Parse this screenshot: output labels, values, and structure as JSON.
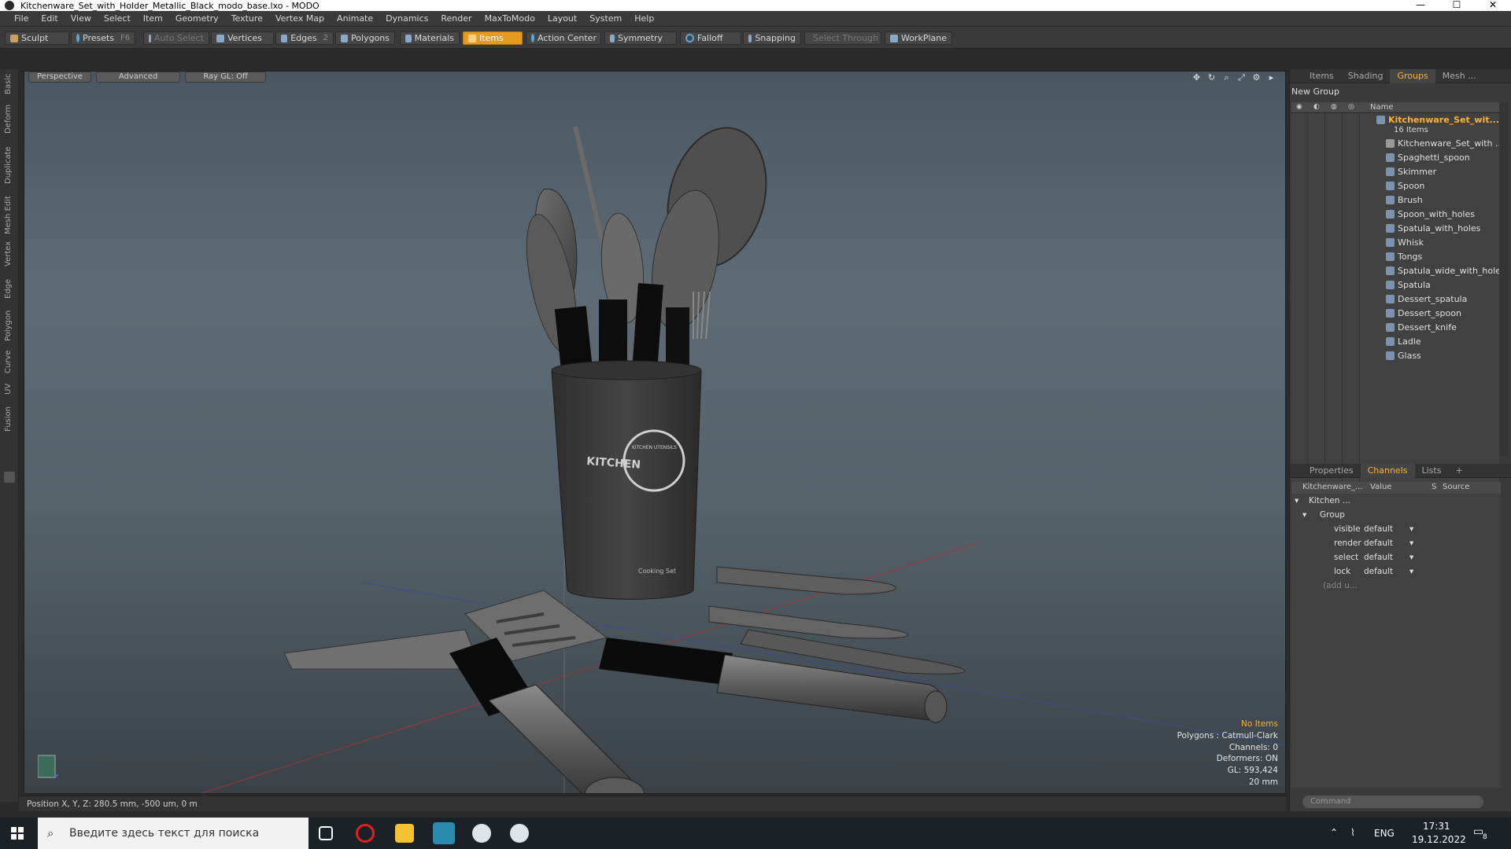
{
  "window": {
    "title": "Kitchenware_Set_with_Holder_Metallic_Black_modo_base.lxo - MODO",
    "minimize": "—",
    "maximize": "☐",
    "close": "✕"
  },
  "menu": [
    "File",
    "Edit",
    "View",
    "Select",
    "Item",
    "Geometry",
    "Texture",
    "Vertex Map",
    "Animate",
    "Dynamics",
    "Render",
    "MaxToModo",
    "Layout",
    "System",
    "Help"
  ],
  "toolbar": {
    "sculpt": "Sculpt",
    "presets": "Presets",
    "presets_key": "F6",
    "auto_select": "Auto Select",
    "vertices": "Vertices",
    "edges": "Edges",
    "edges_count": "2",
    "polygons": "Polygons",
    "materials": "Materials",
    "items": "Items",
    "action_center": "Action Center",
    "symmetry": "Symmetry",
    "falloff": "Falloff",
    "snapping": "Snapping",
    "select_through": "Select Through",
    "workplane": "WorkPlane"
  },
  "left_tabs": [
    "Basic",
    "Deform",
    "Duplicate",
    "Mesh Edit",
    "Vertex",
    "Edge",
    "Polygon",
    "Curve",
    "UV",
    "Fusion"
  ],
  "viewport": {
    "view_mode": "Perspective",
    "shading": "Advanced",
    "raygl": "Ray GL: Off",
    "info": {
      "selection": "No Items",
      "polygons": "Polygons : Catmull-Clark",
      "channels": "Channels: 0",
      "deformers": "Deformers: ON",
      "gl": "GL: 593,424",
      "scale": "20 mm"
    },
    "holder_text": "KITCHEN",
    "holder_logo_text": "KITCHEN UTENSILS",
    "holder_bottom_text": "Cooking Set"
  },
  "status": {
    "position": "Position X, Y, Z:  280.5 mm, -500 um, 0 m"
  },
  "top_panel": {
    "tabs": [
      "Items",
      "Shading",
      "Groups",
      "Mesh ..."
    ],
    "active_tab": "Groups",
    "new_group": "New Group",
    "col_name": "Name",
    "group_name": "Kitchenware_Set_wit...",
    "group_count": "16 Items",
    "items": [
      "Kitchenware_Set_with ...",
      "Spaghetti_spoon",
      "Skimmer",
      "Spoon",
      "Brush",
      "Spoon_with_holes",
      "Spatula_with_holes",
      "Whisk",
      "Tongs",
      "Spatula_wide_with_holes",
      "Spatula",
      "Dessert_spatula",
      "Dessert_spoon",
      "Dessert_knife",
      "Ladle",
      "Glass"
    ]
  },
  "bottom_panel": {
    "tabs": [
      "Properties",
      "Channels",
      "Lists",
      "+"
    ],
    "active_tab": "Channels",
    "headers": {
      "name": "Kitchenware_...",
      "value": "Value",
      "s": "S",
      "source": "Source"
    },
    "tree": {
      "root": "Kitchen ...",
      "group": "Group"
    },
    "channels": [
      {
        "name": "visible",
        "value": "default"
      },
      {
        "name": "render",
        "value": "default"
      },
      {
        "name": "select",
        "value": "default"
      },
      {
        "name": "lock",
        "value": "default"
      }
    ],
    "add_user": "(add u...",
    "command_placeholder": "Command"
  },
  "taskbar": {
    "search_placeholder": "Введите здесь текст для поиска",
    "lang": "ENG",
    "time": "17:31",
    "date": "19.12.2022",
    "notif_count": "8"
  },
  "colors": {
    "accent": "#e69a1e",
    "active_tab": "#ffb030"
  }
}
